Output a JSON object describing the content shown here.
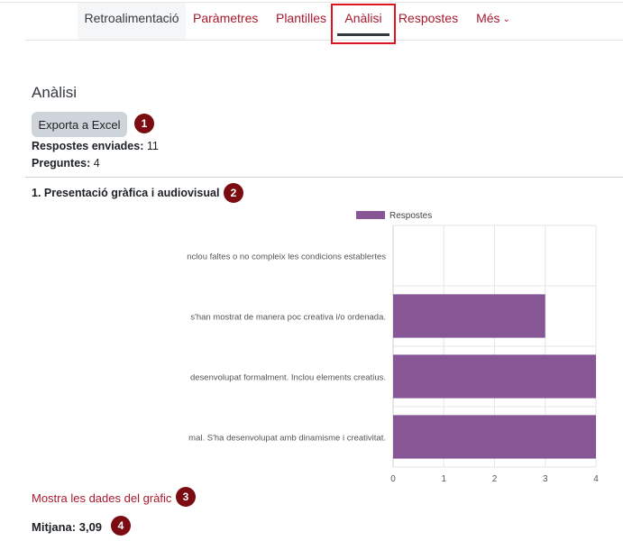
{
  "tabs": [
    {
      "label": "Retroalimentació"
    },
    {
      "label": "Paràmetres"
    },
    {
      "label": "Plantilles"
    },
    {
      "label": "Anàlisi"
    },
    {
      "label": "Respostes"
    },
    {
      "label": "Més"
    }
  ],
  "page": {
    "heading": "Anàlisi",
    "export_label": "Exporta a Excel",
    "submitted_label": "Respostes enviades:",
    "submitted_value": "11",
    "questions_label": "Preguntes:",
    "questions_value": "4",
    "question_title": "1. Presentació gràfica i audiovisual",
    "show_data_link": "Mostra les dades del gràfic",
    "mean_text": "Mitjana: 3,09"
  },
  "markers": [
    "1",
    "2",
    "3",
    "4"
  ],
  "colors": {
    "accent": "#a8192e",
    "bar": "#875695",
    "marker": "#7b0c12",
    "highlight": "#e0141e"
  },
  "chart_data": {
    "type": "bar",
    "orientation": "horizontal",
    "categories": [
      "nclou faltes o no compleix les condicions establertes",
      "s'han mostrat de manera poc creativa i/o ordenada.",
      "desenvolupat formalment. Inclou elements creatius.",
      "mal. S'ha desenvolupat amb dinamisme i creativitat."
    ],
    "series": [
      {
        "name": "Respostes",
        "values": [
          0,
          3,
          4,
          4
        ]
      }
    ],
    "xlim": [
      0,
      4
    ],
    "xticks": [
      "0",
      "1",
      "2",
      "3",
      "4"
    ],
    "grid": true,
    "legend": "top"
  }
}
